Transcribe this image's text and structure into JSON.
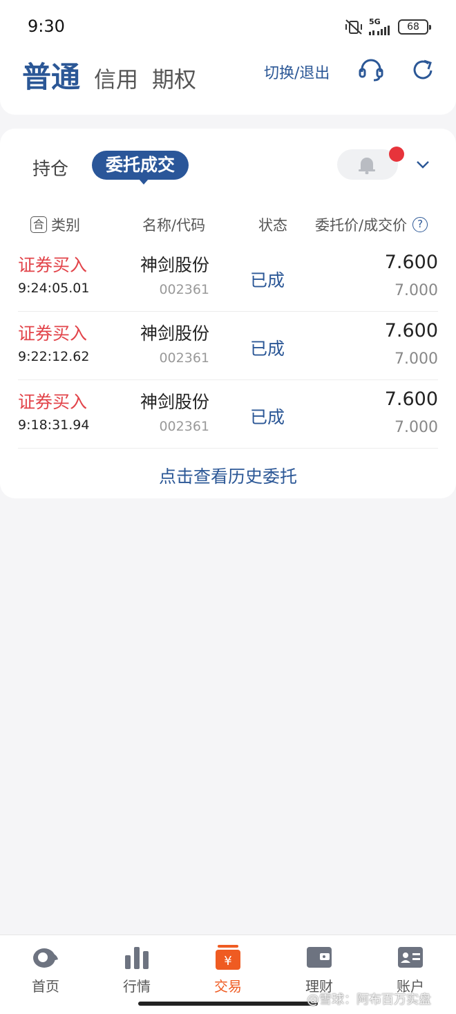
{
  "status_bar": {
    "time": "9:30",
    "network": "5G",
    "battery": "68"
  },
  "header": {
    "tabs": [
      {
        "label": "普通"
      },
      {
        "label": "信用"
      },
      {
        "label": "期权"
      }
    ],
    "switch_exit": "切换/退出",
    "icons": [
      "headset-icon",
      "refresh-icon"
    ],
    "accent_color": "#2b5796"
  },
  "orders": {
    "subtabs": {
      "holdings": "持仓",
      "orders_active": "委托成交"
    },
    "columns": {
      "category": "类别",
      "category_icon": "合",
      "name_code": "名称/代码",
      "status": "状态",
      "price": "委托价/成交价",
      "help_icon": "?"
    },
    "rows": [
      {
        "type": "证券买入",
        "time": "9:24:05.01",
        "name": "神剑股份",
        "code": "002361",
        "status": "已成",
        "order_price": "7.600",
        "deal_price": "7.000"
      },
      {
        "type": "证券买入",
        "time": "9:22:12.62",
        "name": "神剑股份",
        "code": "002361",
        "status": "已成",
        "order_price": "7.600",
        "deal_price": "7.000"
      },
      {
        "type": "证券买入",
        "time": "9:18:31.94",
        "name": "神剑股份",
        "code": "002361",
        "status": "已成",
        "order_price": "7.600",
        "deal_price": "7.000"
      }
    ],
    "history_link": "点击查看历史委托",
    "buy_color": "#e2444a"
  },
  "bottom_nav": {
    "items": [
      {
        "label": "首页",
        "icon": "home-icon"
      },
      {
        "label": "行情",
        "icon": "market-chart-icon"
      },
      {
        "label": "交易",
        "icon": "trade-icon",
        "active": true
      },
      {
        "label": "理财",
        "icon": "wallet-icon"
      },
      {
        "label": "账户",
        "icon": "account-card-icon"
      }
    ],
    "active_color": "#ef5b22"
  },
  "watermark": "@雪球：阿布百万实盘"
}
